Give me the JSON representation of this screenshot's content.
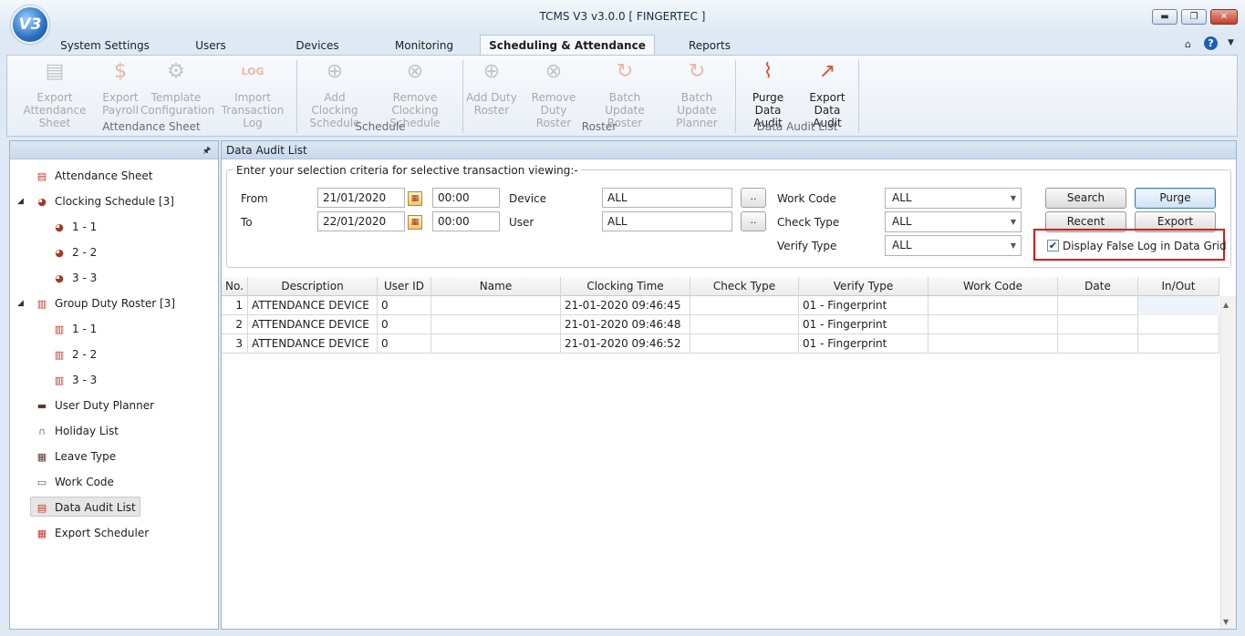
{
  "window": {
    "title": "TCMS V3 v3.0.0 [ FINGERTEC ]",
    "logo_text": "V3"
  },
  "tabs": [
    "System Settings",
    "Users",
    "Devices",
    "Monitoring",
    "Scheduling & Attendance",
    "Reports"
  ],
  "ribbon": {
    "attendance_sheet": {
      "group": "Attendance Sheet",
      "buttons": [
        {
          "l1": "Export",
          "l2": "Attendance Sheet"
        },
        {
          "l1": "Export",
          "l2": "Payroll"
        },
        {
          "l1": "Template",
          "l2": "Configuration"
        },
        {
          "l1": "Import",
          "l2": "Transaction Log"
        }
      ]
    },
    "schedule": {
      "group": "Schedule",
      "buttons": [
        {
          "l1": "Add Clocking",
          "l2": "Schedule"
        },
        {
          "l1": "Remove Clocking",
          "l2": "Schedule"
        }
      ]
    },
    "roster": {
      "group": "Roster",
      "buttons": [
        {
          "l1": "Add Duty",
          "l2": "Roster"
        },
        {
          "l1": "Remove Duty",
          "l2": "Roster"
        },
        {
          "l1": "Batch Update",
          "l2": "Roster"
        },
        {
          "l1": "Batch Update",
          "l2": "Planner"
        }
      ]
    },
    "data_audit": {
      "group": "Data Audit List",
      "buttons": [
        {
          "l1": "Purge Data",
          "l2": "Audit"
        },
        {
          "l1": "Export",
          "l2": "Data Audit"
        }
      ]
    }
  },
  "tree": {
    "attendance_sheet": "Attendance Sheet",
    "clocking_schedule": "Clocking Schedule [3]",
    "cs_items": [
      "1 - 1",
      "2 - 2",
      "3 - 3"
    ],
    "group_duty_roster": "Group Duty Roster [3]",
    "gdr_items": [
      "1 - 1",
      "2 - 2",
      "3 - 3"
    ],
    "user_duty_planner": "User Duty Planner",
    "holiday_list": "Holiday List",
    "leave_type": "Leave Type",
    "work_code": "Work Code",
    "data_audit_list": "Data Audit List",
    "export_scheduler": "Export Scheduler"
  },
  "main": {
    "title": "Data Audit List",
    "criteria_legend": "Enter your selection criteria for selective transaction viewing:-",
    "from_label": "From",
    "to_label": "To",
    "from_date": "21/01/2020",
    "from_time": "00:00",
    "to_date": "22/01/2020",
    "to_time": "00:00",
    "device_label": "Device",
    "device_value": "ALL",
    "user_label": "User",
    "user_value": "ALL",
    "dots": "..",
    "work_code_label": "Work Code",
    "work_code_value": "ALL",
    "check_type_label": "Check Type",
    "check_type_value": "ALL",
    "verify_type_label": "Verify Type",
    "verify_type_value": "ALL",
    "search": "Search",
    "purge": "Purge",
    "recent": "Recent",
    "export": "Export",
    "display_false_log": "Display False Log in Data Grid",
    "display_false_log_checked": true
  },
  "grid": {
    "columns": [
      "No.",
      "Description",
      "User ID",
      "Name",
      "Clocking Time",
      "Check Type",
      "Verify Type",
      "Work Code",
      "Date",
      "In/Out"
    ],
    "rows": [
      [
        "1",
        "ATTENDANCE DEVICE",
        "0",
        "",
        "21-01-2020 09:46:45",
        "",
        "01 - Fingerprint",
        "",
        "",
        ""
      ],
      [
        "2",
        "ATTENDANCE DEVICE",
        "0",
        "",
        "21-01-2020 09:46:48",
        "",
        "01 - Fingerprint",
        "",
        "",
        ""
      ],
      [
        "3",
        "ATTENDANCE DEVICE",
        "0",
        "",
        "21-01-2020 09:46:52",
        "",
        "01 - Fingerprint",
        "",
        "",
        ""
      ]
    ]
  },
  "colors": {
    "highlight_box": "#e01515",
    "accent": "#2a6fc0"
  }
}
